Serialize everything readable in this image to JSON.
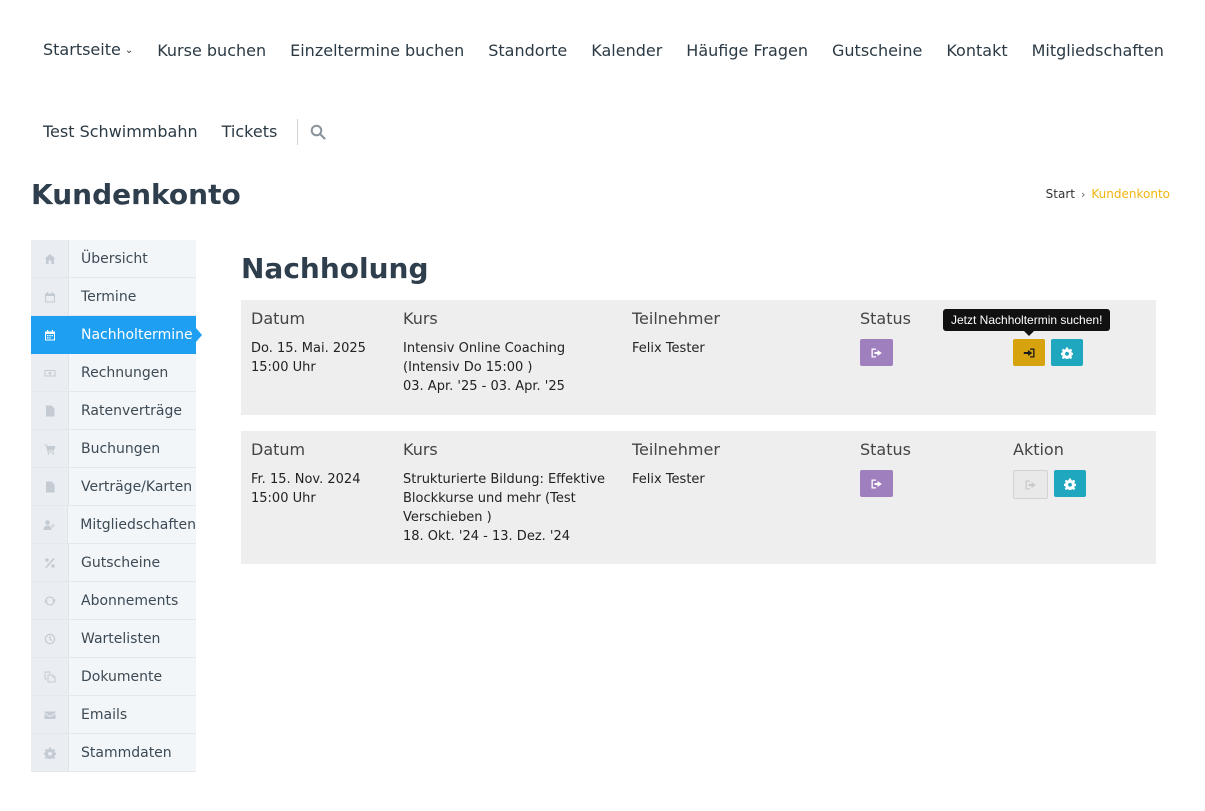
{
  "nav": {
    "row1": [
      {
        "label": "Startseite",
        "has_dropdown": true
      },
      {
        "label": "Kurse buchen"
      },
      {
        "label": "Einzeltermine buchen"
      },
      {
        "label": "Standorte"
      },
      {
        "label": "Kalender"
      },
      {
        "label": "Häufige Fragen"
      },
      {
        "label": "Gutscheine"
      },
      {
        "label": "Kontakt"
      },
      {
        "label": "Mitgliedschaften"
      }
    ],
    "row2": [
      {
        "label": "Test Schwimmbahn"
      },
      {
        "label": "Tickets"
      }
    ],
    "dropdown_glyph": "⌄",
    "search_icon": "search-icon"
  },
  "page": {
    "title": "Kundenkonto",
    "breadcrumb": {
      "start": "Start",
      "separator": "›",
      "current": "Kundenkonto"
    }
  },
  "sidebar": {
    "items": [
      {
        "label": "Übersicht",
        "icon": "home-icon"
      },
      {
        "label": "Termine",
        "icon": "calendar-icon"
      },
      {
        "label": "Nachholtermine",
        "icon": "calendar-icon",
        "active": true
      },
      {
        "label": "Rechnungen",
        "icon": "money-icon"
      },
      {
        "label": "Ratenverträge",
        "icon": "file-icon"
      },
      {
        "label": "Buchungen",
        "icon": "cart-icon"
      },
      {
        "label": "Verträge/Karten",
        "icon": "file-icon"
      },
      {
        "label": "Mitgliedschaften",
        "icon": "user-plus-icon"
      },
      {
        "label": "Gutscheine",
        "icon": "percent-icon"
      },
      {
        "label": "Abonnements",
        "icon": "refresh-icon"
      },
      {
        "label": "Wartelisten",
        "icon": "clock-icon"
      },
      {
        "label": "Dokumente",
        "icon": "copy-icon"
      },
      {
        "label": "Emails",
        "icon": "envelope-icon"
      },
      {
        "label": "Stammdaten",
        "icon": "gear-icon"
      }
    ]
  },
  "main": {
    "section_title": "Nachholung",
    "tooltip": "Jetzt Nachholtermin suchen!",
    "cards": [
      {
        "headers": {
          "datum": "Datum",
          "kurs": "Kurs",
          "teilnehmer": "Teilnehmer",
          "status": "Status",
          "aktion": ""
        },
        "datum": [
          "Do. 15. Mai. 2025",
          "15:00 Uhr"
        ],
        "kurs": [
          "Intensiv Online Coaching",
          "(Intensiv Do 15:00 )",
          "03. Apr. '25 - 03. Apr. '25"
        ],
        "teilnehmer": "Felix Tester",
        "status_icon": "sign-out-icon",
        "actions": [
          {
            "icon": "sign-in-icon",
            "style": "gold"
          },
          {
            "icon": "gear-icon",
            "style": "teal"
          }
        ]
      },
      {
        "headers": {
          "datum": "Datum",
          "kurs": "Kurs",
          "teilnehmer": "Teilnehmer",
          "status": "Status",
          "aktion": "Aktion"
        },
        "datum": [
          "Fr. 15. Nov. 2024",
          "15:00 Uhr"
        ],
        "kurs": [
          "Strukturierte Bildung: Effektive",
          "Blockkurse und mehr (Test",
          "Verschieben )",
          "18. Okt. '24 - 13. Dez. '24"
        ],
        "teilnehmer": "Felix Tester",
        "status_icon": "sign-out-icon",
        "actions": [
          {
            "icon": "sign-out-icon",
            "style": "disabled"
          },
          {
            "icon": "gear-icon",
            "style": "teal"
          }
        ]
      }
    ]
  },
  "colors": {
    "accent_blue": "#1e9ff2",
    "breadcrumb_current": "#f0b50f",
    "status_purple": "#a07fbe",
    "action_gold": "#d6a20e",
    "action_teal": "#1fa7c0"
  }
}
